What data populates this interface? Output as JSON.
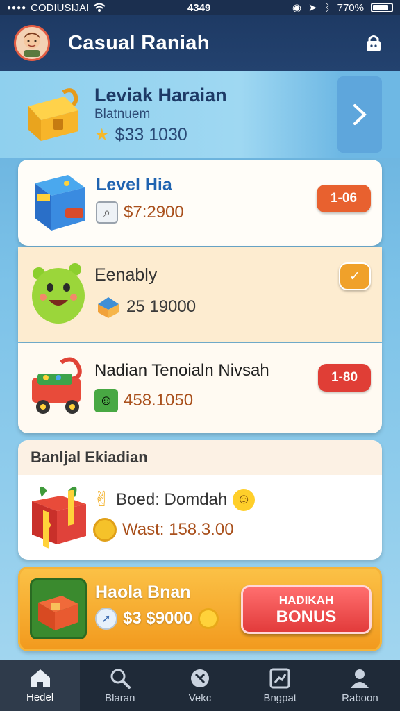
{
  "status_bar": {
    "carrier": "CODIUSIJAI",
    "time": "4349",
    "battery": "770%",
    "battery_level": 0.77
  },
  "header": {
    "title": "Casual Raniah"
  },
  "banner": {
    "title": "Leviak Haraian",
    "subtitle": "Blatnuem",
    "price": "$33 1030"
  },
  "offers": [
    {
      "title": "Level Hia",
      "price": "$7:2900",
      "badge": "1-06",
      "badge_color": "#e8612f"
    },
    {
      "title": "Eenably",
      "price": "25 19000",
      "badge": "✓",
      "badge_color": "#f0a12a"
    },
    {
      "title": "Nadian Tenoialn Nivsah",
      "price": "458.1050",
      "badge": "1-80",
      "badge_color": "#e03e36"
    }
  ],
  "rewards": {
    "heading": "Banljal Ekiadian",
    "line1": "Boed: Domdah",
    "line2": "Wast: 158.3.00"
  },
  "promo": {
    "title": "Haola Bnan",
    "price": "$3 $9000",
    "button_line1": "HADIKAH",
    "button_line2": "BONUS"
  },
  "tabs": [
    {
      "label": "Hedel",
      "icon": "home-icon"
    },
    {
      "label": "Blaran",
      "icon": "search-icon"
    },
    {
      "label": "Vekc",
      "icon": "tag-icon"
    },
    {
      "label": "Bngpat",
      "icon": "chart-icon"
    },
    {
      "label": "Raboon",
      "icon": "profile-icon"
    }
  ]
}
